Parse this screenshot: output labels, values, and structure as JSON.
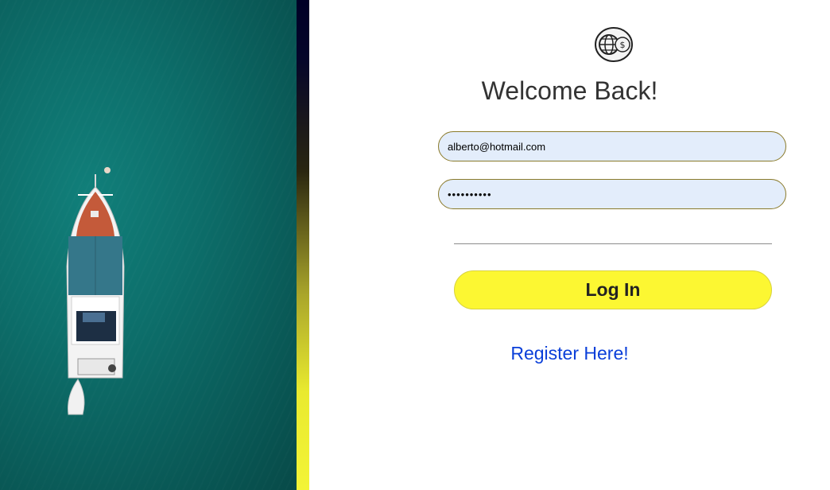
{
  "hero": {
    "image": "boat-aerial-image"
  },
  "logo": {
    "icon": "globe-dollar-logo-icon"
  },
  "login": {
    "title": "Welcome Back!",
    "email_value": "alberto@hotmail.com",
    "password_value": "••••••••••",
    "login_label": "Log In",
    "register_label": "Register Here!"
  },
  "colors": {
    "ocean": "#0d6f6b",
    "strip_top": "#000026",
    "strip_bottom": "#f3f436",
    "input_bg": "#e3edfb",
    "input_border": "#8a7a2a",
    "button_bg": "#fcf732",
    "link": "#0a3fd9",
    "title": "#333333"
  }
}
